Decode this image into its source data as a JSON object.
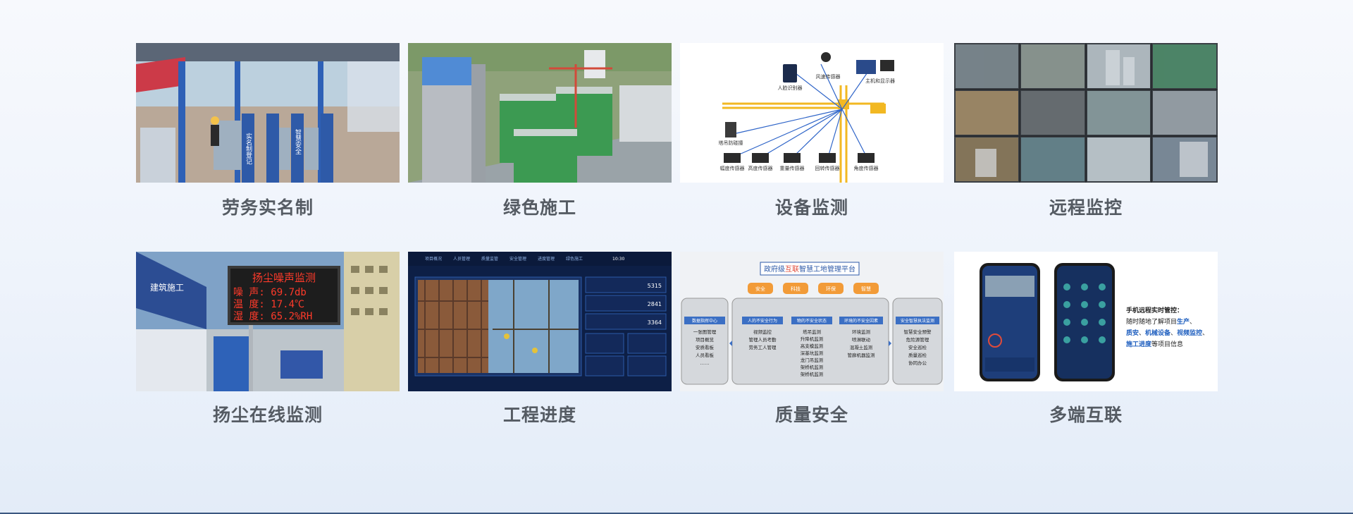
{
  "cards": [
    {
      "title": "劳务实名制",
      "sign1": "实名制登记",
      "sign2": "智慧安全"
    },
    {
      "title": "绿色施工"
    },
    {
      "title": "设备监测",
      "labels": [
        "人脸识别器",
        "风速传感器",
        "主机和显示器",
        "塔吊防碰撞",
        "幅度传感器",
        "高度传感器",
        "重量传感器",
        "回转传感器",
        "角度传感器"
      ]
    },
    {
      "title": "远程监控"
    },
    {
      "title": "扬尘在线监测",
      "led_title": "扬尘噪声监测",
      "led_rows": [
        "噪 声: 69.7db",
        "温 度: 17.4℃",
        "湿 度: 65.2%RH"
      ],
      "banner": "建筑施工"
    },
    {
      "title": "工程进度",
      "tabs": [
        "项目概况",
        "人员管理",
        "质量监管",
        "安全管理",
        "进度管理",
        "绿色施工"
      ],
      "stats": [
        "5315",
        "2841",
        "3364"
      ],
      "clock": "10:30"
    },
    {
      "title": "质量安全",
      "header": "政府级 互联 智慧工地管理平台",
      "header_parts": [
        "政府级",
        "互联",
        "智慧工地管理平台"
      ],
      "chips": [
        "安全",
        "科技",
        "环保",
        "智慧"
      ],
      "left_title": "数据指挥中心",
      "left_items": [
        "一张图管理",
        "项目概览",
        "安质看板",
        "人员看板",
        "……"
      ],
      "col1_title": "人的不安全行为",
      "col1_items": [
        "视频监控",
        "管理人员考勤",
        "劳务工人管理"
      ],
      "col2_title": "物的不安全状态",
      "col2_items": [
        "塔吊监测",
        "升降机监测",
        "高支模监测",
        "深基坑监测",
        "龙门吊监测",
        "架桥机监测",
        "架桥机监测"
      ],
      "col3_title": "环境的不安全因素",
      "col3_items": [
        "环境监测",
        "喷淋联动",
        "混凝土监测",
        "管廊机器监测"
      ],
      "right_title": "安全智慧执法监测",
      "right_items": [
        "智慧安全预警",
        "危险源管理",
        "安全巡检",
        "质量巡检",
        "协同办公"
      ]
    },
    {
      "title": "多端互联",
      "text_title": "手机远程实时管控：",
      "text_l1": "随时随地了解项目",
      "hl1": "生产",
      "sep1": "、",
      "hl2": "质安",
      "sep2": "、",
      "hl3": "机械设备",
      "sep3": "、",
      "hl4": "视频监控",
      "sep4": "、",
      "hl5": "施工进度",
      "text_tail": "等项目信息"
    }
  ],
  "colors": {
    "label": "#555b63",
    "accent": "#1f5fbf",
    "orange": "#f29b38",
    "crane": "#f2b822"
  }
}
